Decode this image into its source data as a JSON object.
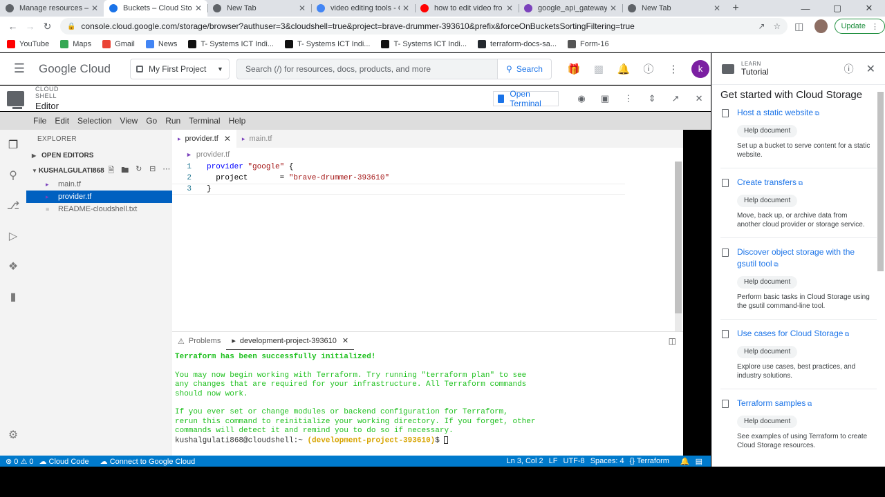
{
  "browser": {
    "tabs": [
      {
        "label": "Manage resources – M",
        "active": false,
        "icon": "gear-icon"
      },
      {
        "label": "Buckets – Cloud Stora",
        "active": true,
        "icon": "storage-icon"
      },
      {
        "label": "New Tab",
        "active": false,
        "icon": "chrome-icon"
      },
      {
        "label": "video editing tools - G",
        "active": false,
        "icon": "google-icon"
      },
      {
        "label": "how to edit video fro",
        "active": false,
        "icon": "youtube-icon"
      },
      {
        "label": "google_api_gateway_",
        "active": false,
        "icon": "terraform-icon"
      },
      {
        "label": "New Tab",
        "active": false,
        "icon": "chrome-icon"
      }
    ],
    "url": "console.cloud.google.com/storage/browser?authuser=3&cloudshell=true&project=brave-drummer-393610&prefix&forceOnBucketsSortingFiltering=true",
    "update_label": "Update",
    "bookmarks": [
      {
        "label": "YouTube",
        "color": "#ff0000"
      },
      {
        "label": "Maps",
        "color": "#34a853"
      },
      {
        "label": "Gmail",
        "color": "#ea4335"
      },
      {
        "label": "News",
        "color": "#4285f4"
      },
      {
        "label": "T- Systems ICT Indi...",
        "color": "#111111"
      },
      {
        "label": "T- Systems ICT Indi...",
        "color": "#111111"
      },
      {
        "label": "T- Systems ICT Indi...",
        "color": "#111111"
      },
      {
        "label": "terraform-docs-sa...",
        "color": "#24292e"
      },
      {
        "label": "Form-16",
        "color": "#555555"
      }
    ]
  },
  "gcp": {
    "logo_google": "Google",
    "logo_cloud": " Cloud",
    "project": "My First Project",
    "search_placeholder": "Search (/) for resources, docs, products, and more",
    "search_button": "Search",
    "avatar_letter": "k"
  },
  "shell": {
    "small_title": "CLOUD SHELL",
    "title": "Editor",
    "open_terminal": "Open Terminal"
  },
  "menu": [
    "File",
    "Edit",
    "Selection",
    "View",
    "Go",
    "Run",
    "Terminal",
    "Help"
  ],
  "explorer": {
    "title": "EXPLORER",
    "open_editors": "OPEN EDITORS",
    "workspace": "KUSHALGULATI868",
    "files": [
      {
        "name": "main.tf",
        "selected": false,
        "type": "tf"
      },
      {
        "name": "provider.tf",
        "selected": true,
        "type": "tf"
      },
      {
        "name": "README-cloudshell.txt",
        "selected": false,
        "type": "txt"
      }
    ]
  },
  "editor": {
    "tabs": [
      {
        "label": "provider.tf",
        "active": true
      },
      {
        "label": "main.tf",
        "active": false
      }
    ],
    "breadcrumb": "provider.tf",
    "lines": [
      {
        "num": "1",
        "parts": [
          {
            "t": "provider ",
            "c": "kw"
          },
          {
            "t": "\"google\"",
            "c": "str"
          },
          {
            "t": " {",
            "c": ""
          }
        ]
      },
      {
        "num": "2",
        "parts": [
          {
            "t": "  project       = ",
            "c": ""
          },
          {
            "t": "\"brave-drummer-393610\"",
            "c": "str"
          }
        ]
      },
      {
        "num": "3",
        "parts": [
          {
            "t": "}",
            "c": ""
          }
        ]
      }
    ]
  },
  "panel": {
    "problems_tab": "Problems",
    "terminal_tab": "development-project-393610",
    "terminal_lines": [
      {
        "t": "Terraform has been successfully initialized!",
        "c": "bold"
      },
      {
        "t": "",
        "c": ""
      },
      {
        "t": "You may now begin working with Terraform. Try running \"terraform plan\" to see",
        "c": ""
      },
      {
        "t": "any changes that are required for your infrastructure. All Terraform commands",
        "c": ""
      },
      {
        "t": "should now work.",
        "c": ""
      },
      {
        "t": "",
        "c": ""
      },
      {
        "t": "If you ever set or change modules or backend configuration for Terraform,",
        "c": ""
      },
      {
        "t": "rerun this command to reinitialize your working directory. If you forget, other",
        "c": ""
      },
      {
        "t": "commands will detect it and remind you to do so if necessary.",
        "c": ""
      }
    ],
    "prompt_user": "kushalgulati868@cloudshell:~ ",
    "prompt_project": "(development-project-393610)",
    "prompt_suffix": "$ "
  },
  "statusbar": {
    "problems": "⊗ 0 ⚠ 0",
    "cloud_code": "Cloud Code",
    "connect": "Connect to Google Cloud",
    "position": "Ln 3, Col 2",
    "eol": "LF",
    "encoding": "UTF-8",
    "spaces": "Spaces: 4",
    "language": "Terraform"
  },
  "tutorial": {
    "small": "LEARN",
    "title": "Tutorial",
    "heading": "Get started with Cloud Storage",
    "items": [
      {
        "title": "Host a static website",
        "chip": "Help document",
        "desc": "Set up a bucket to serve content for a static website."
      },
      {
        "title": "Create transfers",
        "chip": "Help document",
        "desc": "Move, back up, or archive data from another cloud provider or storage service."
      },
      {
        "title": "Discover object storage with the gsutil tool",
        "chip": "Help document",
        "desc": "Perform basic tasks in Cloud Storage using the gsutil command-line tool."
      },
      {
        "title": "Use cases for Cloud Storage",
        "chip": "Help document",
        "desc": "Explore use cases, best practices, and industry solutions."
      },
      {
        "title": "Terraform samples",
        "chip": "Help document",
        "desc": "See examples of using Terraform to create Cloud Storage resources."
      }
    ]
  }
}
